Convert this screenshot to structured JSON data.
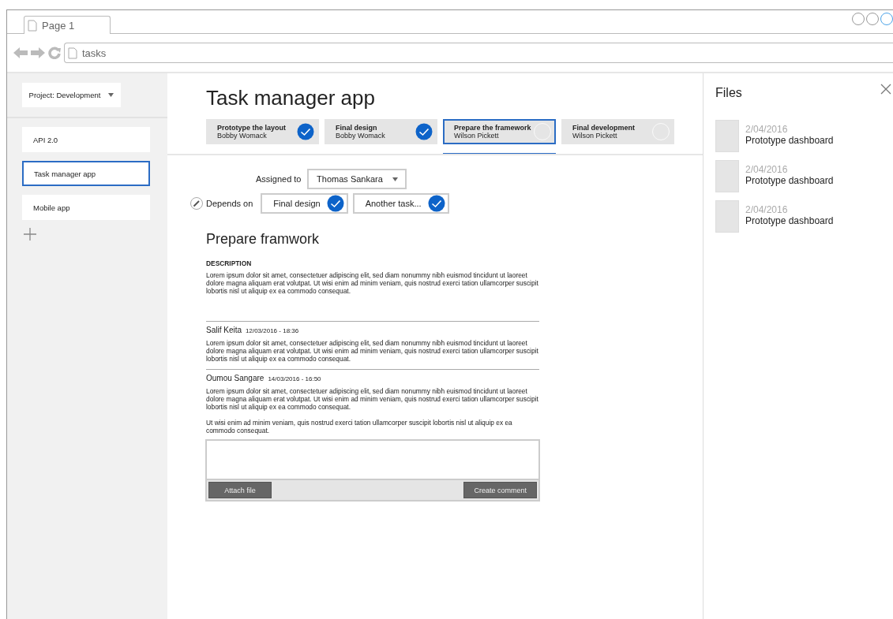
{
  "browser": {
    "tab": "Page 1",
    "address": "tasks"
  },
  "sidebar": {
    "project_select": "Project: Development",
    "projects": [
      {
        "label": "API 2.0",
        "selected": false
      },
      {
        "label": "Task manager app",
        "selected": true
      },
      {
        "label": "Mobile app",
        "selected": false
      }
    ]
  },
  "main": {
    "title": "Task manager app",
    "stages": [
      {
        "title": "Prototype the layout",
        "assignee": "Bobby Womack",
        "done": true,
        "selected": false
      },
      {
        "title": "Final design",
        "assignee": "Bobby Womack",
        "done": true,
        "selected": false
      },
      {
        "title": "Prepare the framework",
        "assignee": "Wilson Pickett",
        "done": false,
        "selected": true
      },
      {
        "title": "Final development",
        "assignee": "Wilson Pickett",
        "done": false,
        "selected": false
      }
    ],
    "assigned_label": "Assigned to",
    "assigned_value": "Thomas Sankara",
    "depends_label": "Depends on",
    "dependencies": [
      {
        "label": "Final design",
        "done": true
      },
      {
        "label": "Another task...",
        "done": true
      }
    ],
    "task_title": "Prepare framwork",
    "description_heading": "DESCRIPTION",
    "description": "Lorem ipsum dolor sit amet, consectetuer adipiscing elit, sed diam nonummy nibh euismod tincidunt ut laoreet dolore magna aliquam erat volutpat. Ut wisi enim ad minim veniam, quis nostrud exerci tation ullamcorper suscipit lobortis nisl ut aliquip ex ea commodo consequat.",
    "comments": [
      {
        "author": "Salif Keita",
        "time": "12/03/2016 - 18:36",
        "paragraphs": [
          "Lorem ipsum dolor sit amet, consectetuer adipiscing elit, sed diam nonummy nibh euismod tincidunt ut laoreet dolore magna aliquam erat volutpat. Ut wisi enim ad minim veniam, quis nostrud exerci tation ullamcorper suscipit lobortis nisl ut aliquip ex ea commodo consequat."
        ]
      },
      {
        "author": "Oumou Sangare",
        "time": "14/03/2016 - 16:50",
        "paragraphs": [
          "Lorem ipsum dolor sit amet, consectetuer adipiscing elit, sed diam nonummy nibh euismod tincidunt ut laoreet dolore magna aliquam erat volutpat. Ut wisi enim ad minim veniam, quis nostrud exerci tation ullamcorper suscipit lobortis nisl ut aliquip ex ea commodo consequat.",
          "Ut wisi enim ad minim veniam, quis nostrud exerci tation ullamcorper suscipit lobortis nisl ut aliquip ex ea commodo consequat."
        ]
      }
    ],
    "attach_button": "Attach file",
    "create_button": "Create comment"
  },
  "files": {
    "title": "Files",
    "items": [
      {
        "date": "2/04/2016",
        "name": "Prototype dashboard"
      },
      {
        "date": "2/04/2016",
        "name": "Prototype dashboard"
      },
      {
        "date": "2/04/2016",
        "name": "Prototype dashboard"
      }
    ]
  }
}
